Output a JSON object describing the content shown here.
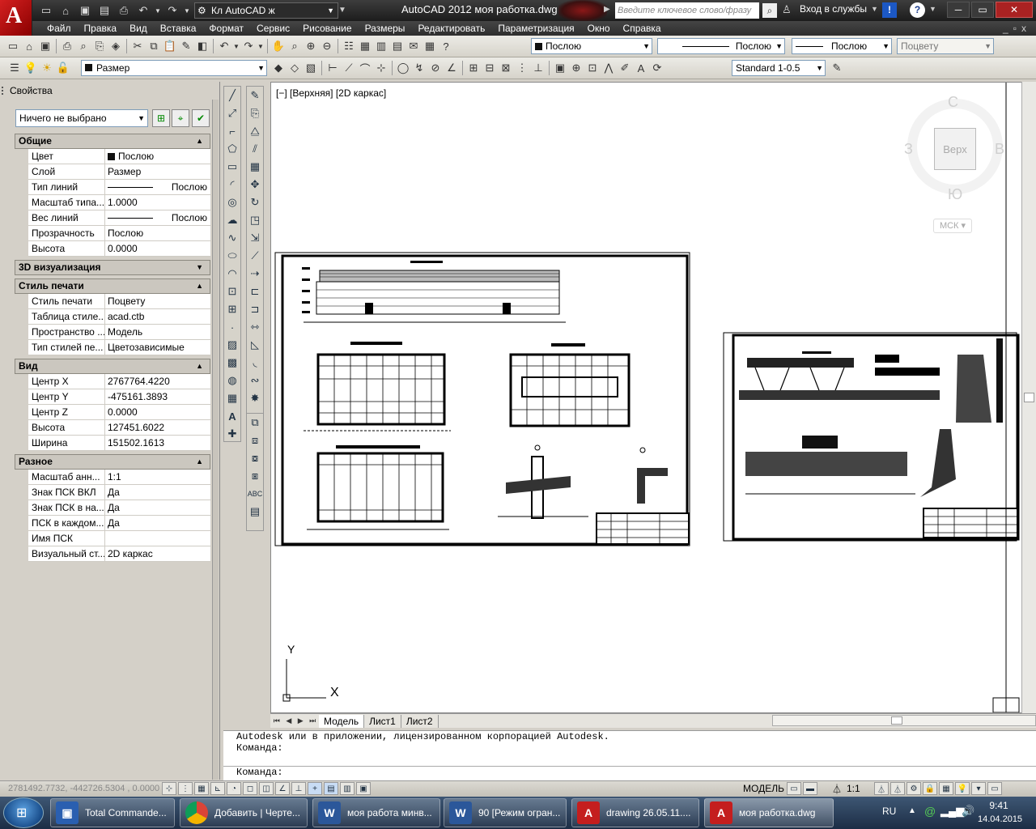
{
  "app": {
    "logo_letter": "A",
    "workspace": "Кл AutoCAD ж",
    "title": "AutoCAD 2012    моя работка.dwg",
    "search_placeholder": "Введите ключевое слово/фразу",
    "login_label": "Вход в службы",
    "help_label": "?",
    "controls": {
      "minimize": "─",
      "maximize": "▭",
      "close": "✕"
    }
  },
  "menu": [
    "Файл",
    "Правка",
    "Вид",
    "Вставка",
    "Формат",
    "Сервис",
    "Рисование",
    "Размеры",
    "Редактировать",
    "Параметризация",
    "Окно",
    "Справка"
  ],
  "menu_controls": {
    "minimize": "_",
    "restore": "▫",
    "close": "x"
  },
  "toolbar1": {
    "color_combo": "Послою",
    "linetype_combo": "Послою",
    "lineweight_combo": "Послою",
    "plotstyle_combo": "Поцвету"
  },
  "toolbar2": {
    "layer_combo": "Размер",
    "dimstyle_combo": "Standard 1-0.5"
  },
  "properties": {
    "title": "Свойства",
    "selection": "Ничего не выбрано",
    "sections": [
      {
        "name": "Общие",
        "toggle": "▲",
        "rows": [
          {
            "k": "Цвет",
            "v": "Послою"
          },
          {
            "k": "Слой",
            "v": "Размер"
          },
          {
            "k": "Тип линий",
            "v": "Послою"
          },
          {
            "k": "Масштаб типа...",
            "v": "1.0000"
          },
          {
            "k": "Вес линий",
            "v": "Послою"
          },
          {
            "k": "Прозрачность",
            "v": "Послою"
          },
          {
            "k": "Высота",
            "v": "0.0000"
          }
        ]
      },
      {
        "name": "3D визуализация",
        "toggle": "▼",
        "rows": []
      },
      {
        "name": "Стиль печати",
        "toggle": "▲",
        "rows": [
          {
            "k": "Стиль печати",
            "v": "Поцвету"
          },
          {
            "k": "Таблица стиле...",
            "v": "acad.ctb"
          },
          {
            "k": "Пространство ...",
            "v": "Модель"
          },
          {
            "k": "Тип стилей пе...",
            "v": "Цветозависимые"
          }
        ]
      },
      {
        "name": "Вид",
        "toggle": "▲",
        "rows": [
          {
            "k": "Центр X",
            "v": "2767764.4220"
          },
          {
            "k": "Центр Y",
            "v": "-475161.3893"
          },
          {
            "k": "Центр Z",
            "v": "0.0000"
          },
          {
            "k": "Высота",
            "v": "127451.6022"
          },
          {
            "k": "Ширина",
            "v": "151502.1613"
          }
        ]
      },
      {
        "name": "Разное",
        "toggle": "▲",
        "rows": [
          {
            "k": "Масштаб анн...",
            "v": "1:1"
          },
          {
            "k": "Знак ПСК ВКЛ",
            "v": "Да"
          },
          {
            "k": "Знак ПСК в на...",
            "v": "Да"
          },
          {
            "k": "ПСК в каждом...",
            "v": "Да"
          },
          {
            "k": "Имя ПСК",
            "v": ""
          },
          {
            "k": "Визуальный ст...",
            "v": "2D каркас"
          }
        ]
      }
    ]
  },
  "viewport": {
    "label": "[−] [Верхняя] [2D каркас]",
    "viewcube": {
      "n": "С",
      "s": "Ю",
      "w": "З",
      "e": "В",
      "face": "Верх",
      "wcs": "МСК"
    },
    "ucs": {
      "x": "X",
      "y": "Y"
    }
  },
  "tabs": [
    "Модель",
    "Лист1",
    "Лист2"
  ],
  "command": {
    "lines": [
      "Autodesk или в приложении, лицензированном корпорацией Autodesk.",
      "Команда:"
    ],
    "prompt": "Команда:"
  },
  "status": {
    "coords": "2781492.7732, -442726.5304 , 0.0000",
    "space": "МОДЕЛЬ",
    "scale": "1:1"
  },
  "taskbar": {
    "items": [
      {
        "label": "Total Commande...",
        "icon": "floppy-icon",
        "color": "#2a5fb0"
      },
      {
        "label": "Добавить | Черте...",
        "icon": "chrome-icon",
        "color": "#e0b020"
      },
      {
        "label": "моя работа минв...",
        "icon": "word-icon",
        "color": "#2b579a"
      },
      {
        "label": "90 [Режим огран...",
        "icon": "word-icon",
        "color": "#2b579a"
      },
      {
        "label": "drawing 26.05.11....",
        "icon": "autocad-icon",
        "color": "#c41e1e"
      },
      {
        "label": "моя работка.dwg",
        "icon": "autocad-icon",
        "color": "#c41e1e"
      }
    ],
    "lang": "RU",
    "time": "9:41",
    "date": "14.04.2015"
  }
}
